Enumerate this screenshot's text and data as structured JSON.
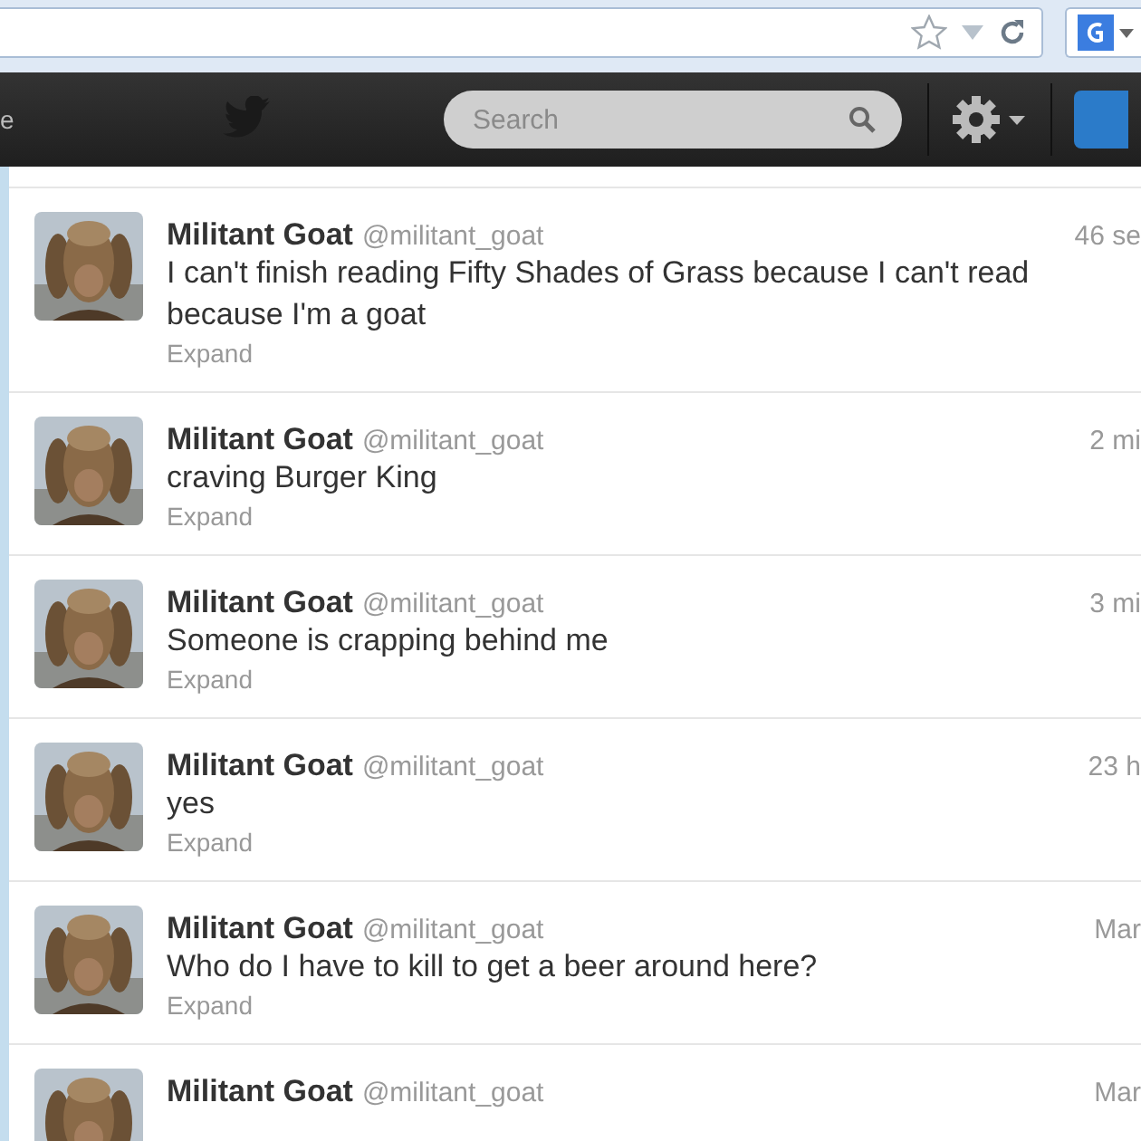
{
  "nav": {
    "partial_link": "e",
    "search": {
      "placeholder": "Search"
    }
  },
  "tweets": [
    {
      "name": "Militant Goat",
      "handle": "@militant_goat",
      "time": "46 se",
      "text": "I can't finish reading Fifty Shades of Grass because I can't read because I'm a goat",
      "action": "Expand"
    },
    {
      "name": "Militant Goat",
      "handle": "@militant_goat",
      "time": "2 mi",
      "text": "craving Burger King",
      "action": "Expand"
    },
    {
      "name": "Militant Goat",
      "handle": "@militant_goat",
      "time": "3 mi",
      "text": "Someone is crapping behind me",
      "action": "Expand"
    },
    {
      "name": "Militant Goat",
      "handle": "@militant_goat",
      "time": "23 h",
      "text": "yes",
      "action": "Expand"
    },
    {
      "name": "Militant Goat",
      "handle": "@militant_goat",
      "time": "Mar",
      "text": "Who do I have to kill to get a beer around here?",
      "action": "Expand"
    },
    {
      "name": "Militant Goat",
      "handle": "@militant_goat",
      "time": "Mar"
    }
  ]
}
